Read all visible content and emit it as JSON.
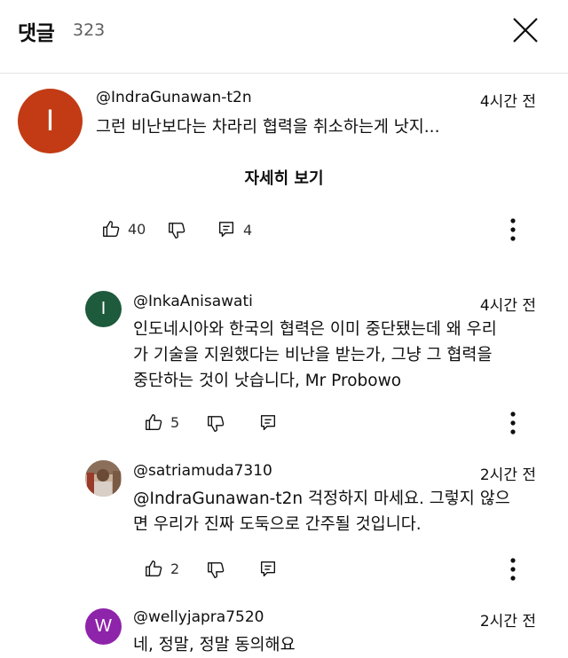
{
  "header": {
    "title": "댓글",
    "count": "323"
  },
  "comments": [
    {
      "author": "@IndraGunawan-t2n",
      "time": "4시간 전",
      "text": "그런 비난보다는 차라리 협력을 취소하는게 낫지...",
      "read_more": "자세히 보기",
      "likes": "40",
      "replies": "4",
      "avatar_letter": "I",
      "avatar_color": "#c23b14"
    },
    {
      "author": "@InkaAnisawati",
      "time": "4시간 전",
      "lines": [
        "인도네시아와 한국의 협력은 이미 중단됐는데 왜 우리",
        "가 기술을 지원했다는 비난을 받는가, 그냥 그 협력을",
        "중단하는 것이 낫습니다, Mr Probowo"
      ],
      "likes": "5",
      "avatar_letter": "I",
      "avatar_color": "#1e5a3c"
    },
    {
      "author": "@satriamuda7310",
      "time": "2시간 전",
      "lines": [
        "@IndraGunawan-t2n 걱정하지 마세요. 그렇지 않으",
        "면 우리가 진짜 도둑으로 간주될 것입니다."
      ],
      "likes": "2"
    },
    {
      "author": "@wellyjapra7520",
      "time": "2시간 전",
      "lines": [
        "네, 정말, 정말 동의해요"
      ],
      "avatar_letter": "W",
      "avatar_color": "#8e24aa"
    }
  ]
}
